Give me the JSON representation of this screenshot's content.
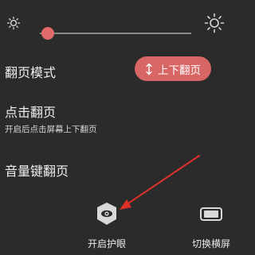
{
  "brightness": {
    "level": 0.05,
    "min_icon": "sun-small-icon",
    "max_icon": "sun-large-icon"
  },
  "settings": {
    "page_mode": {
      "label": "翻页模式",
      "button_label": "上下翻页",
      "button_icon": "vertical-arrows-icon",
      "button_color": "#d86665"
    },
    "tap_page": {
      "label": "点击翻页",
      "description": "开启后点击屏幕上下翻页"
    },
    "volume_page": {
      "label": "音量键翻页"
    }
  },
  "tools": {
    "eye_protection": {
      "label": "开启护眼",
      "icon": "eye-shield-icon"
    },
    "landscape": {
      "label": "切换横屏",
      "icon": "landscape-phone-icon"
    }
  },
  "annotation": {
    "color": "#e0302a",
    "icon": "red-arrow-annotation"
  },
  "theme": {
    "background": "#2b2b2b",
    "accent": "#e16b6b"
  }
}
